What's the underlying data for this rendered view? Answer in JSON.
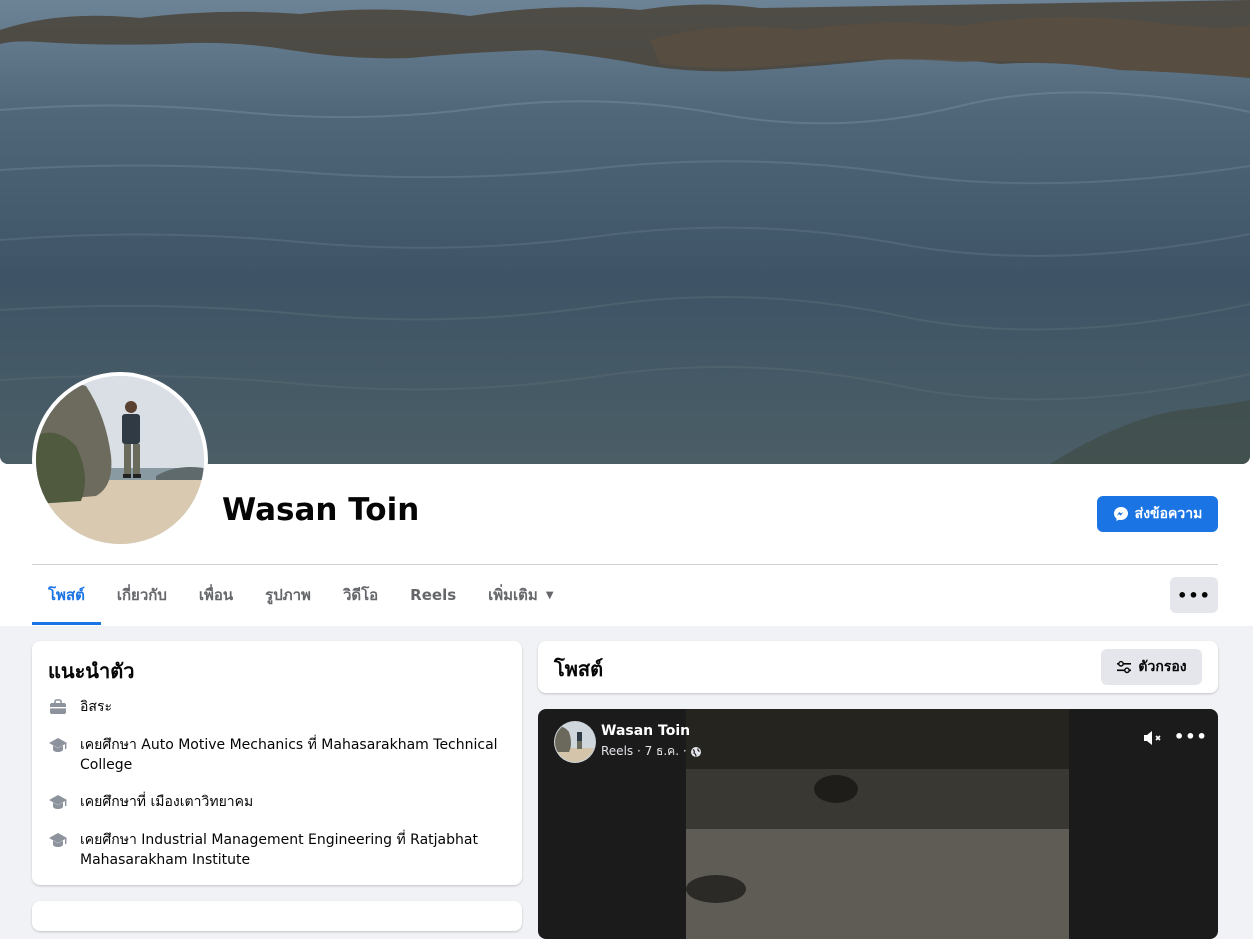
{
  "profile": {
    "name": "Wasan Toin",
    "message_button": "ส่งข้อความ"
  },
  "tabs": [
    {
      "label": "โพสต์",
      "active": true
    },
    {
      "label": "เกี่ยวกับ",
      "active": false
    },
    {
      "label": "เพื่อน",
      "active": false
    },
    {
      "label": "รูปภาพ",
      "active": false
    },
    {
      "label": "วิดีโอ",
      "active": false
    },
    {
      "label": "Reels",
      "active": false
    },
    {
      "label": "เพิ่มเติม",
      "active": false
    }
  ],
  "more_button": "•••",
  "intro": {
    "title": "แนะนำตัว",
    "items": [
      {
        "icon": "briefcase-icon",
        "text": "อิสระ"
      },
      {
        "icon": "graduation-cap-icon",
        "text": "เคยศึกษา Auto Motive Mechanics ที่ Mahasarakham Technical College"
      },
      {
        "icon": "graduation-cap-icon",
        "text": "เคยศึกษาที่ เมืองเตาวิทยาคม"
      },
      {
        "icon": "graduation-cap-icon",
        "text": "เคยศึกษา Industrial Management Engineering ที่ Ratjabhat Mahasarakham Institute"
      }
    ]
  },
  "posts": {
    "title": "โพสต์",
    "filter_label": "ตัวกรอง"
  },
  "reel_post": {
    "author": "Wasan Toin",
    "meta": "Reels · 7 ธ.ค. ·",
    "more": "•••"
  },
  "colors": {
    "accent": "#1b74e4",
    "background": "#f0f2f5",
    "card": "#ffffff",
    "secondary_button": "#e4e6eb"
  }
}
